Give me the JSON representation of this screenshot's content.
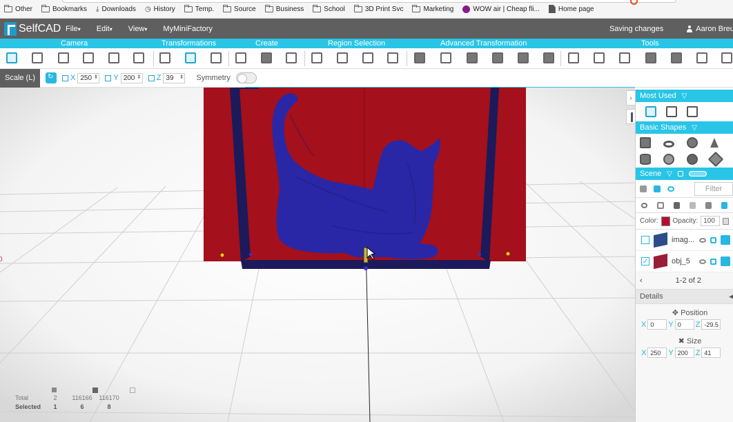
{
  "bookmarks": [
    {
      "label": "Other",
      "icon": "folder-icon"
    },
    {
      "label": "Bookmarks",
      "icon": "folder-icon"
    },
    {
      "label": "Downloads",
      "icon": "download-icon"
    },
    {
      "label": "History",
      "icon": "history-icon"
    },
    {
      "label": "Temp.",
      "icon": "folder-icon"
    },
    {
      "label": "Source",
      "icon": "folder-icon"
    },
    {
      "label": "Business",
      "icon": "folder-icon"
    },
    {
      "label": "School",
      "icon": "folder-icon"
    },
    {
      "label": "3D Print Svc",
      "icon": "folder-icon"
    },
    {
      "label": "Marketing",
      "icon": "folder-icon"
    },
    {
      "label": "WOW air | Cheap fli...",
      "icon": "wow-icon"
    },
    {
      "label": "Home page",
      "icon": "page-icon"
    }
  ],
  "menubar": {
    "logo": "SelfCAD",
    "items": [
      "File",
      "Edit",
      "View",
      "MyMiniFactory"
    ],
    "status": "Saving changes",
    "user": "Aaron Breue"
  },
  "categories": [
    "Camera",
    "Transformations",
    "Create",
    "Region Selection",
    "Advanced Transformation",
    "Tools"
  ],
  "options": {
    "mode": "Scale (L)",
    "x_label": "X",
    "x_value": "250",
    "y_label": "Y",
    "y_value": "200",
    "z_label": "Z",
    "z_value": "39",
    "symmetry_label": "Symmetry"
  },
  "stats": {
    "header": [
      "Total",
      "2",
      "116166",
      "116170"
    ],
    "selected": [
      "Selected",
      "1",
      "6",
      "8"
    ]
  },
  "panel": {
    "most_used": "Most Used",
    "basic_shapes": "Basic Shapes",
    "scene": "Scene",
    "filter_placeholder": "Filter",
    "color_label": "Color:",
    "opacity_label": "Opacity:",
    "opacity_value": "100",
    "color_value": "#b4102e",
    "objects": [
      {
        "name": "imag...",
        "checked": false
      },
      {
        "name": "obj_5",
        "checked": true
      }
    ],
    "pager": "1-2 of 2",
    "details": "Details",
    "position_label": "Position",
    "position": {
      "x": "0",
      "y": "0",
      "z": "-29.5"
    },
    "size_label": "Size",
    "size": {
      "x": "250",
      "y": "200",
      "z": "41"
    }
  },
  "colors": {
    "accent": "#29c5e6",
    "menubar": "#5f5f5f",
    "frame_red": "#a4101b",
    "frame_navy": "#1c1a5a",
    "cat_blue": "#2a27a6"
  }
}
